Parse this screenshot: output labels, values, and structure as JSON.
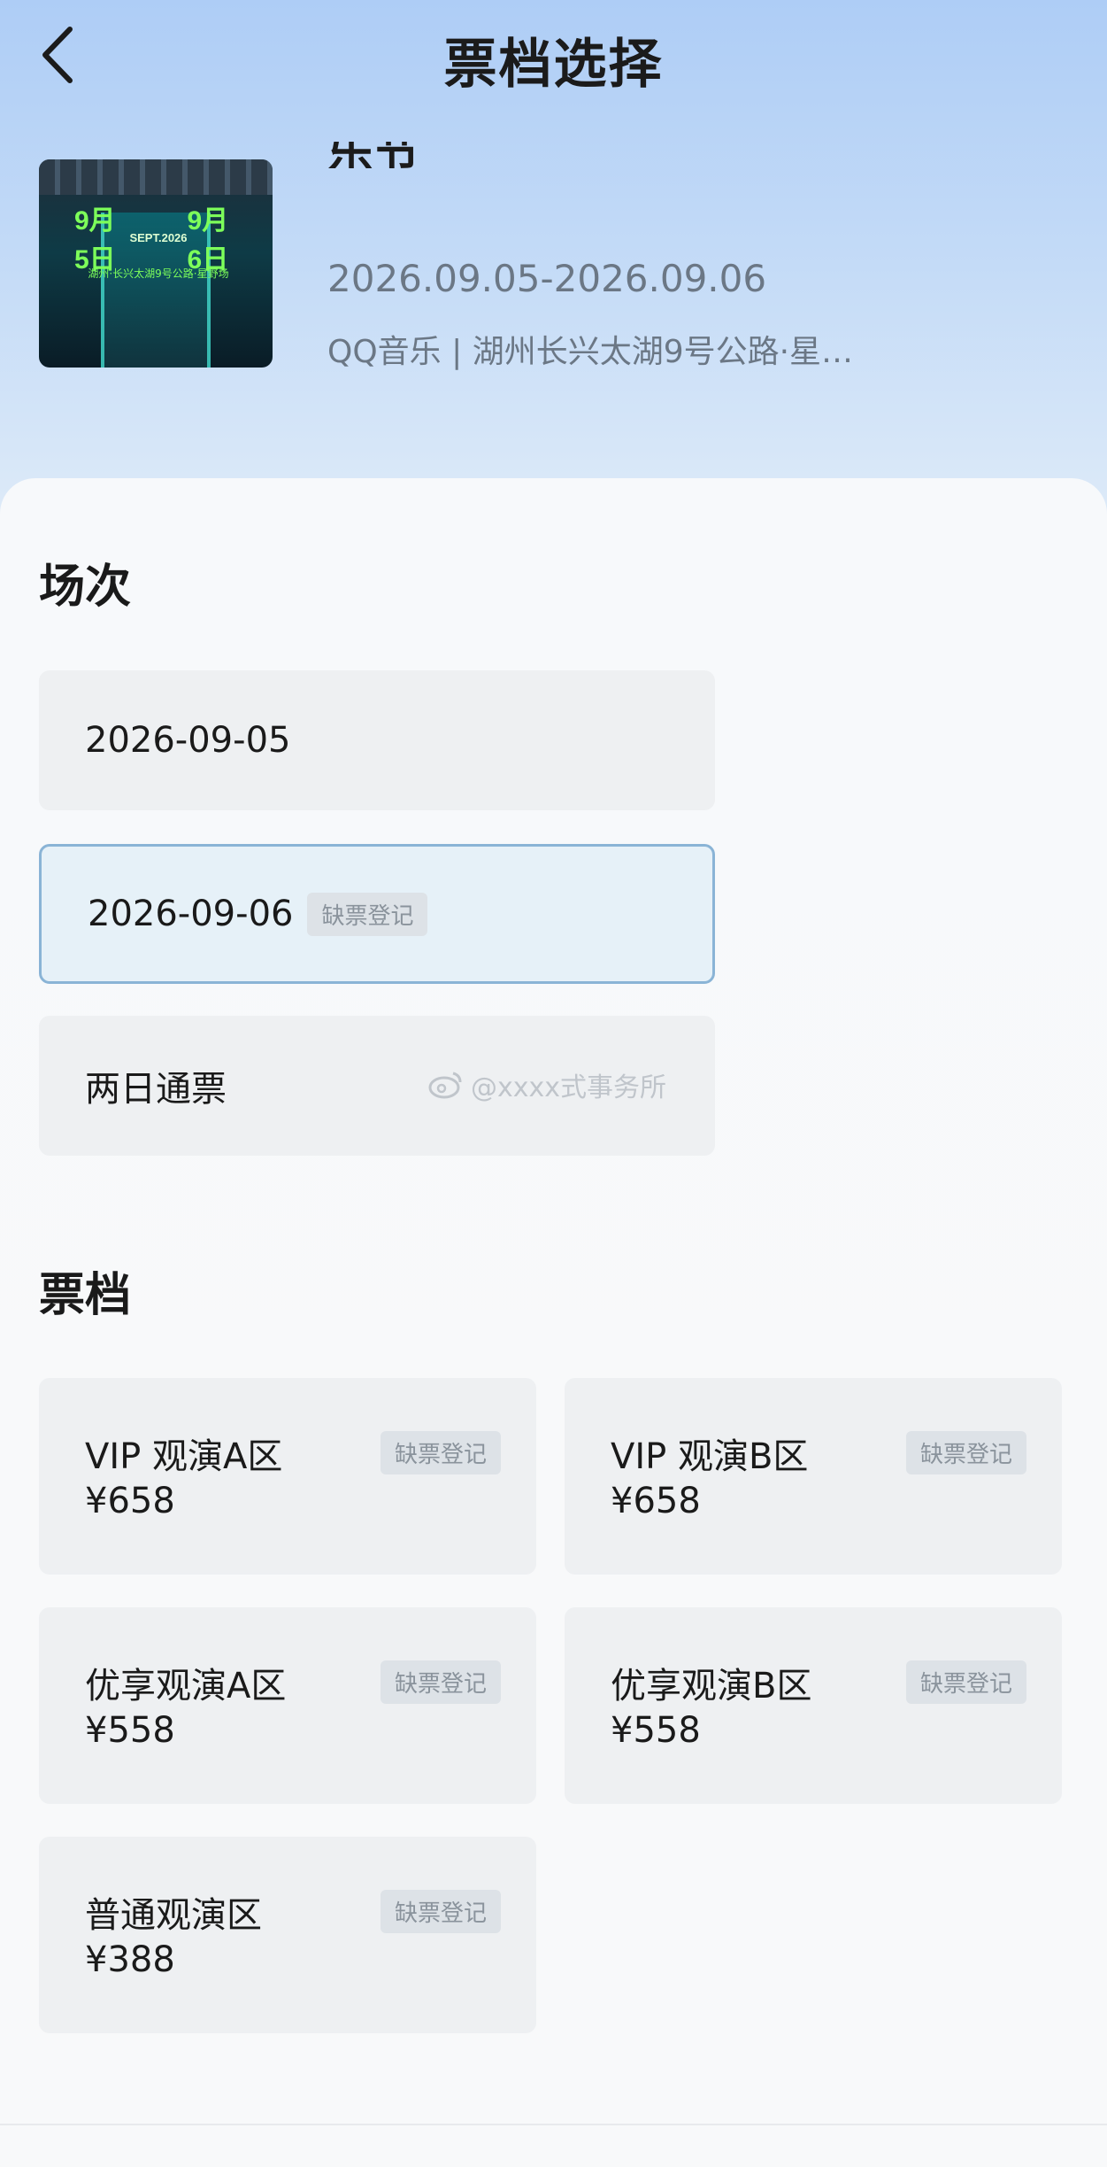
{
  "header": {
    "title": "票档选择"
  },
  "event": {
    "name_partial": "乐节",
    "date_range": "2026.09.05-2026.09.06",
    "venue": "QQ音乐 | 湖州长兴太湖9号公路·星…",
    "poster": {
      "date_left": "9月5日",
      "date_right": "9月6日",
      "date_mid": "SEPT.2026",
      "subtitle": "湖州·长兴太湖9号公路·星野场"
    }
  },
  "sessions": {
    "title": "场次",
    "items": [
      {
        "label": "2026-09-05",
        "tag": ""
      },
      {
        "label": "2026-09-06",
        "tag": "缺票登记"
      },
      {
        "label": "两日通票",
        "tag": ""
      }
    ]
  },
  "watermark": "@xxxx式事务所",
  "tickets": {
    "title": "票档",
    "items": [
      {
        "name": "VIP 观演A区",
        "price": "¥658",
        "tag": "缺票登记"
      },
      {
        "name": "VIP 观演B区",
        "price": "¥658",
        "tag": "缺票登记"
      },
      {
        "name": "优享观演A区",
        "price": "¥558",
        "tag": "缺票登记"
      },
      {
        "name": "优享观演B区",
        "price": "¥558",
        "tag": "缺票登记"
      },
      {
        "name": "普通观演区",
        "price": "¥388",
        "tag": "缺票登记"
      }
    ]
  },
  "colors": {
    "selected_border": "#8ab4d6",
    "selected_bg": "#e6f1f8",
    "card_bg": "#eef0f2",
    "tag_bg": "#dde2e7",
    "muted_text": "#6b7785"
  }
}
